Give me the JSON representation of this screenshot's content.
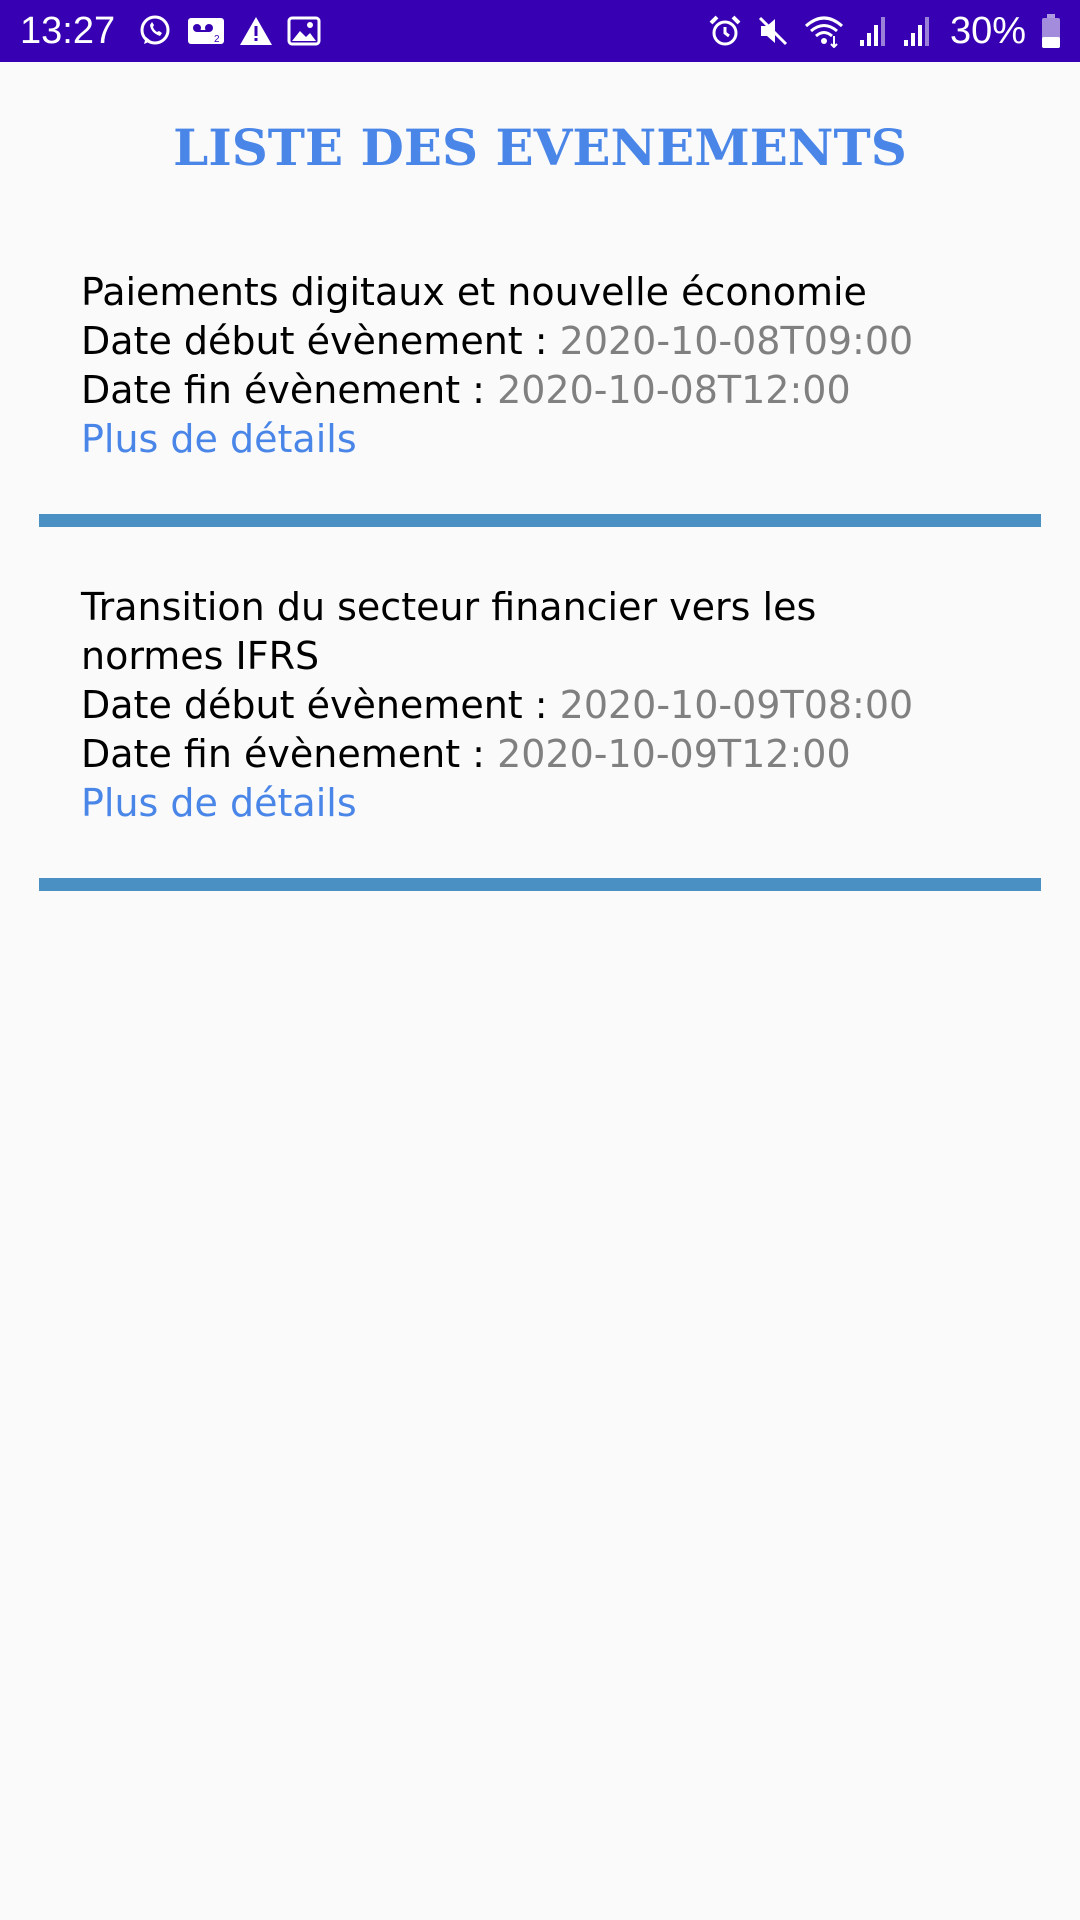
{
  "status_bar": {
    "time": "13:27",
    "battery_percent": "30%",
    "left_icons": [
      "whatsapp-icon",
      "voicemail-icon",
      "warning-icon",
      "image-icon"
    ],
    "right_icons": [
      "alarm-icon",
      "mute-icon",
      "wifi-icon",
      "signal-icon",
      "signal-icon",
      "battery-icon"
    ],
    "background": "#3700b3"
  },
  "page": {
    "title": "LISTE DES EVENEMENTS",
    "title_color": "#4a86e8",
    "divider_color": "#4a90c2"
  },
  "events": [
    {
      "title": "Paiements digitaux et nouvelle économie",
      "start_label": "Date début évènement : ",
      "start_value": "2020-10-08T09:00",
      "end_label": "Date fin évènement : ",
      "end_value": "2020-10-08T12:00",
      "more_label": "Plus de détails"
    },
    {
      "title": "Transition du secteur financier vers les normes IFRS",
      "start_label": "Date début évènement : ",
      "start_value": "2020-10-09T08:00",
      "end_label": "Date fin évènement : ",
      "end_value": "2020-10-09T12:00",
      "more_label": "Plus de détails"
    }
  ]
}
